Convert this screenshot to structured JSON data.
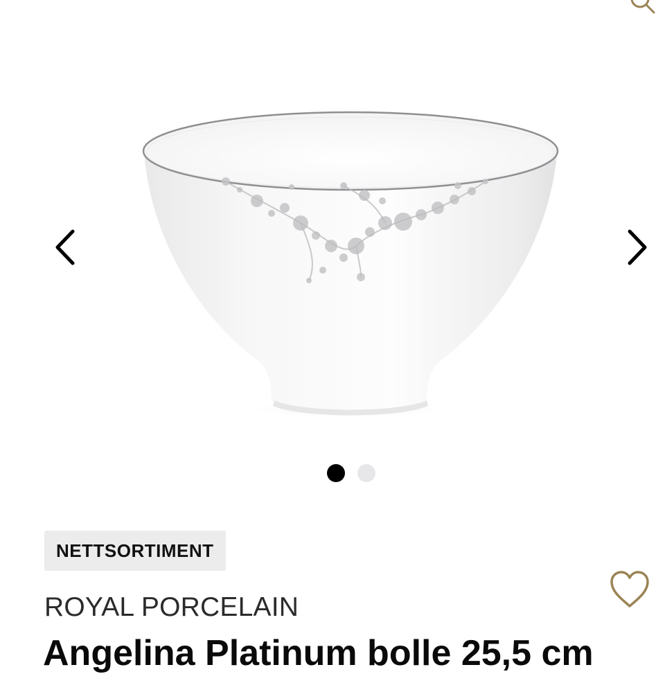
{
  "gallery": {
    "image_alt": "Angelina Platinum bolle 25,5 cm",
    "current_slide": 1,
    "total_slides": 2
  },
  "product": {
    "badge": "NETTSORTIMENT",
    "brand": "ROYAL PORCELAIN",
    "title": "Angelina Platinum bolle 25,5 cm"
  },
  "icons": {
    "prev": "chevron-left-icon",
    "next": "chevron-right-icon",
    "favorite": "heart-outline-icon",
    "search": "search-icon"
  },
  "colors": {
    "accent": "#9a8355",
    "text": "#111111",
    "badge_bg": "#ececec",
    "dot_active": "#000000",
    "dot_inactive": "#e7e7e9"
  }
}
